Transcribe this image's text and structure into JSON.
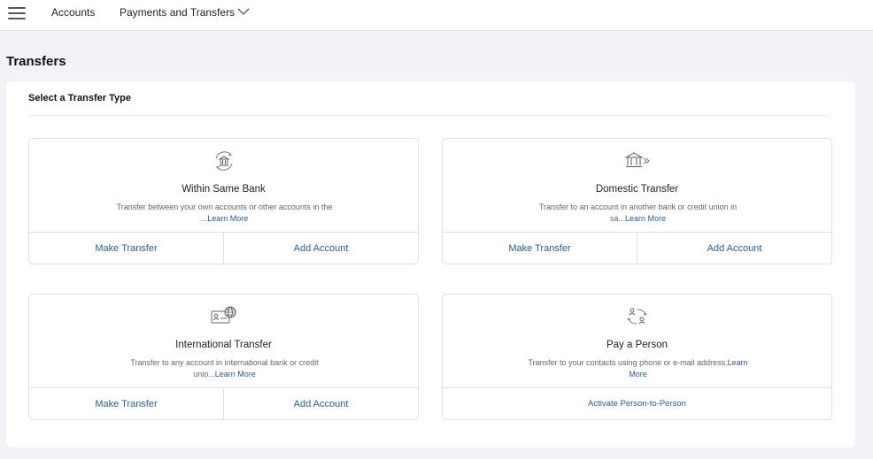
{
  "topbar": {
    "menu_icon": "hamburger-menu-icon",
    "nav": [
      "Accounts",
      "Payments and Transfers"
    ],
    "dropdown_icon": "chevron-down-icon"
  },
  "page": {
    "title": "Transfers"
  },
  "panel": {
    "title": "Select a Transfer Type",
    "cards": [
      {
        "icon": "bank-transfer-icon",
        "name": "Within Same Bank",
        "desc": "Transfer between your own accounts or other accounts in the ...",
        "learn": "Learn More",
        "actions": [
          "Make Transfer",
          "Add Account"
        ]
      },
      {
        "icon": "bank-outgoing-icon",
        "name": "Domestic Transfer",
        "desc": "Transfer to an account in another bank or credit union in sa...",
        "learn": "Learn More",
        "actions": [
          "Make Transfer",
          "Add Account"
        ]
      },
      {
        "icon": "international-card-globe-icon",
        "name": "International Transfer",
        "desc": "Transfer to any account in international bank or credit unio...",
        "learn": "Learn More",
        "actions": [
          "Make Transfer",
          "Add Account"
        ]
      },
      {
        "icon": "person-to-person-icon",
        "name": "Pay a Person",
        "desc": "Transfer to your contacts using phone or e-mail address.",
        "learn": "Learn More",
        "actions": [
          "Activate Person-to-Person"
        ]
      }
    ]
  },
  "colors": {
    "link": "#2a5aa5",
    "background": "#f1f3f6",
    "border": "#dcdfe3"
  }
}
